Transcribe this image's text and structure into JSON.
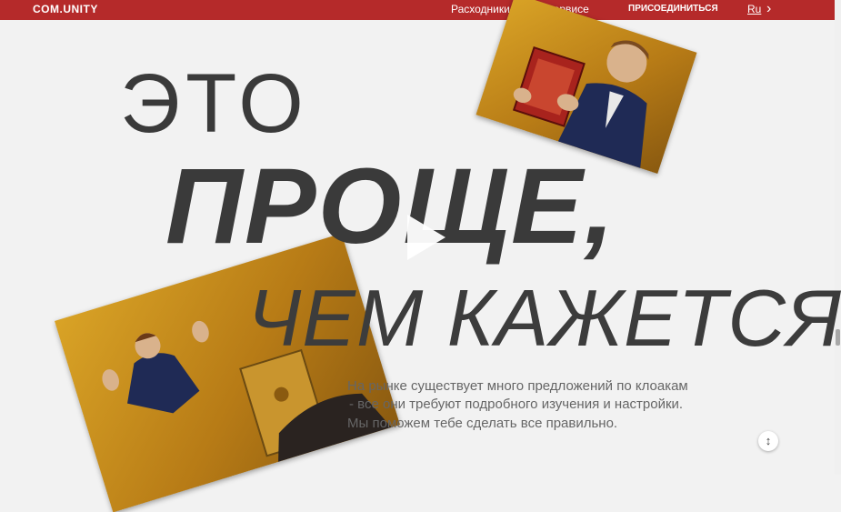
{
  "header": {
    "logo": "COM.UNITY",
    "nav": {
      "supplies": "Расходники",
      "about": "О сервисе",
      "join": "ПРИСОЕДИНИТЬСЯ",
      "lang": "Ru",
      "next": "›"
    }
  },
  "hero": {
    "line1": "ЭТО",
    "line2": "ПРОЩЕ,",
    "line3": "ЧЕМ КАЖЕТСЯ",
    "description": [
      "На рынке существует много предложений по клоакам",
      "- все они требуют подробного изучения и настройки.",
      "Мы поможем тебе сделать все правильно."
    ]
  },
  "controls": {
    "updown": "↕"
  },
  "colors": {
    "brand": "#b52a2a",
    "headline": "#3a3a3a"
  },
  "icons": {
    "play": "play-icon",
    "next": "chevron-right-icon"
  }
}
